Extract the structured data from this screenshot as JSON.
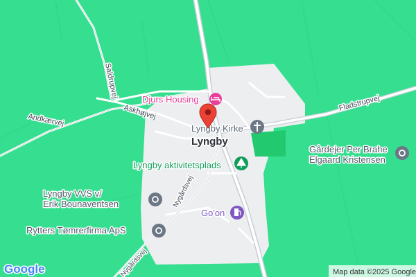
{
  "map": {
    "place": "Lyngby",
    "pois": {
      "djurs_housing": "Djurs Housing",
      "lyngby_kirke": "Lyngby Kirke",
      "aktivitetsplads": "Lyngby aktivitetsplads",
      "gaardejer_line1": "Gårdejer Per Brahe",
      "gaardejer_line2": "Elgaard Kristensen",
      "vvs_line1": "Lyngby VVS v/",
      "vvs_line2": "Erik Bounaventsen",
      "rytters": "Rytters Tømrerfirma ApS",
      "goon": "Go'on"
    },
    "roads": {
      "saldrupvej": "Saldrupvej",
      "askhojvej": "Askhøjvej",
      "andkaervej": "Andkærvej",
      "fladstrupvej": "Fladstrupvej",
      "nygardsvej_1": "Nygårdsvej",
      "nygardsvej_2": "Nygårdsvej"
    },
    "attribution": "Map data ©2025 Google",
    "logo": "Google",
    "colors": {
      "land": "#35df8f",
      "settlement": "#eceef0",
      "park": "#22c96e",
      "hotel_pink": "#e8409a",
      "park_green": "#0f9d58",
      "service_gray": "#6b7785",
      "fuel_purple": "#7e57c2",
      "marker_red": "#ea4335"
    },
    "icons": {
      "hotel": "bed-icon",
      "church": "cross-icon",
      "park": "tree-icon",
      "fuel": "fuel-pump-icon",
      "service": "location-icon",
      "marker": "red-pin-icon"
    }
  }
}
